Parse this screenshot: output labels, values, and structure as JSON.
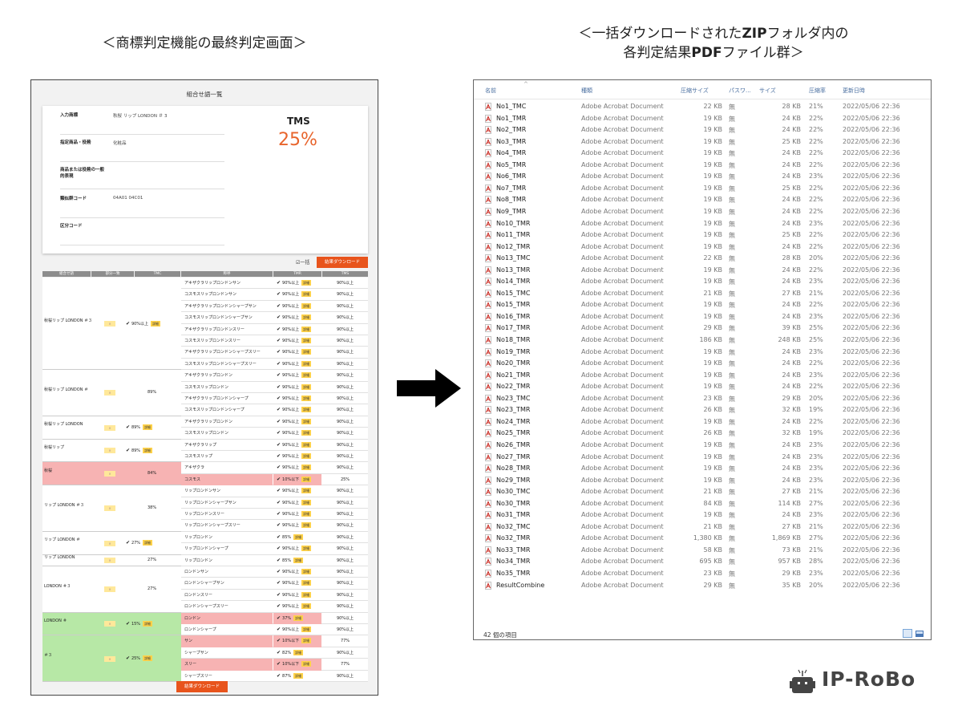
{
  "captions": {
    "left": "＜商標判定機能の最終判定画面＞",
    "right_line1_a": "＜一括ダウンロードされた",
    "right_line1_b": "ZIP",
    "right_line1_c": "フォルダ内の",
    "right_line2_a": "各判定結果",
    "right_line2_b": "PDF",
    "right_line2_c": "ファイル群＞"
  },
  "left_panel": {
    "title": "組合せ語一覧",
    "info": [
      {
        "label": "入力商標",
        "value": "秋桜 リップ LONDON ＃ 3"
      },
      {
        "label": "指定商品・役務",
        "value": "化粧品"
      },
      {
        "label": "商品または役務の一般的表現",
        "value": ""
      },
      {
        "label": "類似群コード",
        "value": "04A01 04C01"
      },
      {
        "label": "区分コード",
        "value": ""
      }
    ],
    "tms_label": "TMS",
    "tms_value": "25%",
    "bulk_label": "一括",
    "download_label": "結果ダウンロード",
    "headers": [
      "組合せ語",
      "部分一致",
      "TMC",
      "称呼",
      "TMR",
      "TMS"
    ],
    "detail_label": "詳細",
    "part_mark": "×",
    "groups": [
      {
        "name": "秋桜リップ LONDON ＃３",
        "tmc": "90%以上",
        "tmc_check": true,
        "rows": 8,
        "color": ""
      },
      {
        "name": "秋桜リップ LONDON ＃",
        "tmc": "89%",
        "tmc_check": false,
        "rows": 4,
        "color": ""
      },
      {
        "name": "秋桜リップ LONDON",
        "tmc": "89%",
        "tmc_check": true,
        "rows": 2,
        "color": ""
      },
      {
        "name": "秋桜リップ",
        "tmc": "89%",
        "tmc_check": true,
        "rows": 2,
        "color": ""
      },
      {
        "name": "秋桜",
        "tmc": "84%",
        "tmc_check": false,
        "rows": 2,
        "color": "red"
      },
      {
        "name": "リップ LONDON ＃３",
        "tmc": "38%",
        "tmc_check": false,
        "rows": 4,
        "color": ""
      },
      {
        "name": "リップ LONDON ＃",
        "tmc": "27%",
        "tmc_check": true,
        "rows": 2,
        "color": ""
      },
      {
        "name": "リップ LONDON",
        "tmc": "27%",
        "tmc_check": false,
        "rows": 1,
        "color": ""
      },
      {
        "name": "LONDON ＃３",
        "tmc": "27%",
        "tmc_check": false,
        "rows": 4,
        "color": ""
      },
      {
        "name": "LONDON ＃",
        "tmc": "15%",
        "tmc_check": true,
        "rows": 2,
        "color": "green"
      },
      {
        "name": "＃３",
        "tmc": "25%",
        "tmc_check": true,
        "rows": 4,
        "color": "green"
      }
    ],
    "rows": [
      {
        "yobi": "アキザクラリップロンドンサン",
        "tmr": "90%以上",
        "tms": "90%以上",
        "red": false
      },
      {
        "yobi": "コスモスリップロンドンサン",
        "tmr": "90%以上",
        "tms": "90%以上",
        "red": false
      },
      {
        "yobi": "アキザクラリップロンドンシャープサン",
        "tmr": "90%以上",
        "tms": "90%以上",
        "red": false
      },
      {
        "yobi": "コスモスリップロンドンシャープサン",
        "tmr": "90%以上",
        "tms": "90%以上",
        "red": false
      },
      {
        "yobi": "アキザクラリップロンドンスリー",
        "tmr": "90%以上",
        "tms": "90%以上",
        "red": false
      },
      {
        "yobi": "コスモスリップロンドンスリー",
        "tmr": "90%以上",
        "tms": "90%以上",
        "red": false
      },
      {
        "yobi": "アキザクラリップロンドンシャープスリー",
        "tmr": "90%以上",
        "tms": "90%以上",
        "red": false
      },
      {
        "yobi": "コスモスリップロンドンシャープスリー",
        "tmr": "90%以上",
        "tms": "90%以上",
        "red": false
      },
      {
        "yobi": "アキザクラリップロンドン",
        "tmr": "90%以上",
        "tms": "90%以上",
        "red": false
      },
      {
        "yobi": "コスモスリップロンドン",
        "tmr": "90%以上",
        "tms": "90%以上",
        "red": false
      },
      {
        "yobi": "アキザクラリップロンドンシャープ",
        "tmr": "90%以上",
        "tms": "90%以上",
        "red": false
      },
      {
        "yobi": "コスモスリップロンドンシャープ",
        "tmr": "90%以上",
        "tms": "90%以上",
        "red": false
      },
      {
        "yobi": "アキザクラリップロンドン",
        "tmr": "90%以上",
        "tms": "90%以上",
        "red": false
      },
      {
        "yobi": "コスモスリップロンドン",
        "tmr": "90%以上",
        "tms": "90%以上",
        "red": false
      },
      {
        "yobi": "アキザクラリップ",
        "tmr": "90%以上",
        "tms": "90%以上",
        "red": false
      },
      {
        "yobi": "コスモスリップ",
        "tmr": "90%以上",
        "tms": "90%以上",
        "red": false
      },
      {
        "yobi": "アキザクラ",
        "tmr": "90%以上",
        "tms": "90%以上",
        "red": false
      },
      {
        "yobi": "コスモス",
        "tmr": "10%以下",
        "tms": "25%",
        "red": true
      },
      {
        "yobi": "リップロンドンサン",
        "tmr": "90%以上",
        "tms": "90%以上",
        "red": false
      },
      {
        "yobi": "リップロンドンシャープサン",
        "tmr": "90%以上",
        "tms": "90%以上",
        "red": false
      },
      {
        "yobi": "リップロンドンスリー",
        "tmr": "90%以上",
        "tms": "90%以上",
        "red": false
      },
      {
        "yobi": "リップロンドンシャープスリー",
        "tmr": "90%以上",
        "tms": "90%以上",
        "red": false
      },
      {
        "yobi": "リップロンドン",
        "tmr": "85%",
        "tms": "90%以上",
        "red": false
      },
      {
        "yobi": "リップロンドンシャープ",
        "tmr": "90%以上",
        "tms": "90%以上",
        "red": false
      },
      {
        "yobi": "リップロンドン",
        "tmr": "85%",
        "tms": "90%以上",
        "red": false
      },
      {
        "yobi": "ロンドンサン",
        "tmr": "90%以上",
        "tms": "90%以上",
        "red": false
      },
      {
        "yobi": "ロンドンシャープサン",
        "tmr": "90%以上",
        "tms": "90%以上",
        "red": false
      },
      {
        "yobi": "ロンドンスリー",
        "tmr": "90%以上",
        "tms": "90%以上",
        "red": false
      },
      {
        "yobi": "ロンドンシャープスリー",
        "tmr": "90%以上",
        "tms": "90%以上",
        "red": false
      },
      {
        "yobi": "ロンドン",
        "tmr": "37%",
        "tms": "90%以上",
        "red": true
      },
      {
        "yobi": "ロンドンシャープ",
        "tmr": "90%以上",
        "tms": "90%以上",
        "red": false
      },
      {
        "yobi": "サン",
        "tmr": "10%以下",
        "tms": "77%",
        "red": true
      },
      {
        "yobi": "シャープサン",
        "tmr": "82%",
        "tms": "90%以上",
        "red": false
      },
      {
        "yobi": "スリー",
        "tmr": "10%以下",
        "tms": "77%",
        "red": true
      },
      {
        "yobi": "シャープスリー",
        "tmr": "87%",
        "tms": "90%以上",
        "red": false
      }
    ]
  },
  "explorer": {
    "headers": {
      "name": "名前",
      "type": "種類",
      "compressed": "圧縮サイズ",
      "password": "パスワ...",
      "size": "サイズ",
      "ratio": "圧縮率",
      "date": "更新日時"
    },
    "files": [
      [
        "No1_TMC",
        "Adobe Acrobat Document",
        "22 KB",
        "無",
        "28 KB",
        "21%",
        "2022/05/06 22:36"
      ],
      [
        "No1_TMR",
        "Adobe Acrobat Document",
        "19 KB",
        "無",
        "24 KB",
        "22%",
        "2022/05/06 22:36"
      ],
      [
        "No2_TMR",
        "Adobe Acrobat Document",
        "19 KB",
        "無",
        "24 KB",
        "22%",
        "2022/05/06 22:36"
      ],
      [
        "No3_TMR",
        "Adobe Acrobat Document",
        "19 KB",
        "無",
        "25 KB",
        "22%",
        "2022/05/06 22:36"
      ],
      [
        "No4_TMR",
        "Adobe Acrobat Document",
        "19 KB",
        "無",
        "24 KB",
        "22%",
        "2022/05/06 22:36"
      ],
      [
        "No5_TMR",
        "Adobe Acrobat Document",
        "19 KB",
        "無",
        "24 KB",
        "22%",
        "2022/05/06 22:36"
      ],
      [
        "No6_TMR",
        "Adobe Acrobat Document",
        "19 KB",
        "無",
        "24 KB",
        "23%",
        "2022/05/06 22:36"
      ],
      [
        "No7_TMR",
        "Adobe Acrobat Document",
        "19 KB",
        "無",
        "25 KB",
        "22%",
        "2022/05/06 22:36"
      ],
      [
        "No8_TMR",
        "Adobe Acrobat Document",
        "19 KB",
        "無",
        "24 KB",
        "22%",
        "2022/05/06 22:36"
      ],
      [
        "No9_TMR",
        "Adobe Acrobat Document",
        "19 KB",
        "無",
        "24 KB",
        "22%",
        "2022/05/06 22:36"
      ],
      [
        "No10_TMR",
        "Adobe Acrobat Document",
        "19 KB",
        "無",
        "24 KB",
        "23%",
        "2022/05/06 22:36"
      ],
      [
        "No11_TMR",
        "Adobe Acrobat Document",
        "19 KB",
        "無",
        "25 KB",
        "22%",
        "2022/05/06 22:36"
      ],
      [
        "No12_TMR",
        "Adobe Acrobat Document",
        "19 KB",
        "無",
        "24 KB",
        "22%",
        "2022/05/06 22:36"
      ],
      [
        "No13_TMC",
        "Adobe Acrobat Document",
        "22 KB",
        "無",
        "28 KB",
        "20%",
        "2022/05/06 22:36"
      ],
      [
        "No13_TMR",
        "Adobe Acrobat Document",
        "19 KB",
        "無",
        "24 KB",
        "22%",
        "2022/05/06 22:36"
      ],
      [
        "No14_TMR",
        "Adobe Acrobat Document",
        "19 KB",
        "無",
        "24 KB",
        "23%",
        "2022/05/06 22:36"
      ],
      [
        "No15_TMC",
        "Adobe Acrobat Document",
        "21 KB",
        "無",
        "27 KB",
        "21%",
        "2022/05/06 22:36"
      ],
      [
        "No15_TMR",
        "Adobe Acrobat Document",
        "19 KB",
        "無",
        "24 KB",
        "22%",
        "2022/05/06 22:36"
      ],
      [
        "No16_TMR",
        "Adobe Acrobat Document",
        "19 KB",
        "無",
        "24 KB",
        "23%",
        "2022/05/06 22:36"
      ],
      [
        "No17_TMR",
        "Adobe Acrobat Document",
        "29 KB",
        "無",
        "39 KB",
        "25%",
        "2022/05/06 22:36"
      ],
      [
        "No18_TMR",
        "Adobe Acrobat Document",
        "186 KB",
        "無",
        "248 KB",
        "25%",
        "2022/05/06 22:36"
      ],
      [
        "No19_TMR",
        "Adobe Acrobat Document",
        "19 KB",
        "無",
        "24 KB",
        "23%",
        "2022/05/06 22:36"
      ],
      [
        "No20_TMR",
        "Adobe Acrobat Document",
        "19 KB",
        "無",
        "24 KB",
        "22%",
        "2022/05/06 22:36"
      ],
      [
        "No21_TMR",
        "Adobe Acrobat Document",
        "19 KB",
        "無",
        "24 KB",
        "23%",
        "2022/05/06 22:36"
      ],
      [
        "No22_TMR",
        "Adobe Acrobat Document",
        "19 KB",
        "無",
        "24 KB",
        "22%",
        "2022/05/06 22:36"
      ],
      [
        "No23_TMC",
        "Adobe Acrobat Document",
        "23 KB",
        "無",
        "29 KB",
        "20%",
        "2022/05/06 22:36"
      ],
      [
        "No23_TMR",
        "Adobe Acrobat Document",
        "26 KB",
        "無",
        "32 KB",
        "19%",
        "2022/05/06 22:36"
      ],
      [
        "No24_TMR",
        "Adobe Acrobat Document",
        "19 KB",
        "無",
        "24 KB",
        "22%",
        "2022/05/06 22:36"
      ],
      [
        "No25_TMR",
        "Adobe Acrobat Document",
        "26 KB",
        "無",
        "32 KB",
        "19%",
        "2022/05/06 22:36"
      ],
      [
        "No26_TMR",
        "Adobe Acrobat Document",
        "19 KB",
        "無",
        "24 KB",
        "23%",
        "2022/05/06 22:36"
      ],
      [
        "No27_TMR",
        "Adobe Acrobat Document",
        "19 KB",
        "無",
        "24 KB",
        "23%",
        "2022/05/06 22:36"
      ],
      [
        "No28_TMR",
        "Adobe Acrobat Document",
        "19 KB",
        "無",
        "24 KB",
        "23%",
        "2022/05/06 22:36"
      ],
      [
        "No29_TMR",
        "Adobe Acrobat Document",
        "19 KB",
        "無",
        "24 KB",
        "23%",
        "2022/05/06 22:36"
      ],
      [
        "No30_TMC",
        "Adobe Acrobat Document",
        "21 KB",
        "無",
        "27 KB",
        "21%",
        "2022/05/06 22:36"
      ],
      [
        "No30_TMR",
        "Adobe Acrobat Document",
        "84 KB",
        "無",
        "114 KB",
        "27%",
        "2022/05/06 22:36"
      ],
      [
        "No31_TMR",
        "Adobe Acrobat Document",
        "19 KB",
        "無",
        "24 KB",
        "23%",
        "2022/05/06 22:36"
      ],
      [
        "No32_TMC",
        "Adobe Acrobat Document",
        "21 KB",
        "無",
        "27 KB",
        "21%",
        "2022/05/06 22:36"
      ],
      [
        "No32_TMR",
        "Adobe Acrobat Document",
        "1,380 KB",
        "無",
        "1,869 KB",
        "27%",
        "2022/05/06 22:36"
      ],
      [
        "No33_TMR",
        "Adobe Acrobat Document",
        "58 KB",
        "無",
        "73 KB",
        "21%",
        "2022/05/06 22:36"
      ],
      [
        "No34_TMR",
        "Adobe Acrobat Document",
        "695 KB",
        "無",
        "957 KB",
        "28%",
        "2022/05/06 22:36"
      ],
      [
        "No35_TMR",
        "Adobe Acrobat Document",
        "23 KB",
        "無",
        "29 KB",
        "23%",
        "2022/05/06 22:36"
      ],
      [
        "ResultCombine",
        "Adobe Acrobat Document",
        "29 KB",
        "無",
        "35 KB",
        "20%",
        "2022/05/06 22:36"
      ]
    ],
    "status": "42 個の項目"
  },
  "logo": {
    "text": "IP-RoBo"
  }
}
